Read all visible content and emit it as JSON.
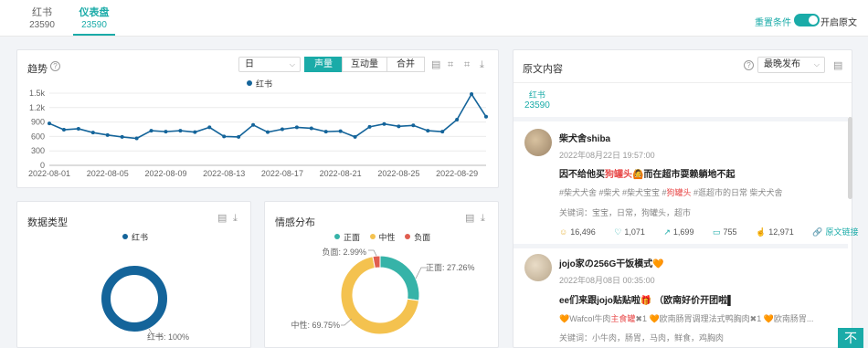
{
  "tabs": [
    {
      "label": "红书",
      "count": "23590"
    },
    {
      "label": "仪表盘",
      "count": "23590"
    }
  ],
  "header": {
    "reset_label": "重置条件",
    "toggle_label": "开启原文",
    "toggle_on": true
  },
  "trend": {
    "title": "趋势",
    "select": "日",
    "segments": [
      "声量",
      "互动量",
      "合并"
    ],
    "active_segment": "声量",
    "legend": "红书"
  },
  "chart_data": [
    {
      "type": "line",
      "title": "",
      "series": [
        {
          "name": "红书",
          "color": "#14649a",
          "values": [
            870,
            740,
            760,
            680,
            630,
            590,
            560,
            720,
            700,
            720,
            690,
            790,
            600,
            590,
            840,
            690,
            750,
            790,
            770,
            700,
            710,
            590,
            800,
            860,
            810,
            830,
            720,
            700,
            950,
            1480,
            1010
          ]
        }
      ],
      "x": [
        "2022-08-01",
        "2022-08-02",
        "2022-08-03",
        "2022-08-04",
        "2022-08-05",
        "2022-08-06",
        "2022-08-07",
        "2022-08-08",
        "2022-08-09",
        "2022-08-10",
        "2022-08-11",
        "2022-08-12",
        "2022-08-13",
        "2022-08-14",
        "2022-08-15",
        "2022-08-16",
        "2022-08-17",
        "2022-08-18",
        "2022-08-19",
        "2022-08-20",
        "2022-08-21",
        "2022-08-22",
        "2022-08-23",
        "2022-08-24",
        "2022-08-25",
        "2022-08-26",
        "2022-08-27",
        "2022-08-28",
        "2022-08-29",
        "2022-08-30",
        "2022-08-31"
      ],
      "x_tick_labels": [
        "2022-08-01",
        "2022-08-05",
        "2022-08-09",
        "2022-08-13",
        "2022-08-17",
        "2022-08-21",
        "2022-08-25",
        "2022-08-29"
      ],
      "y_tick_labels": [
        "0",
        "300",
        "600",
        "900",
        "1.2k",
        "1.5k"
      ],
      "ylim": [
        0,
        1500
      ],
      "grid": true,
      "legend": "top-center"
    },
    {
      "type": "pie",
      "title": "数据类型",
      "labels": [
        "红书"
      ],
      "values": [
        100
      ],
      "colors": [
        "#14649a"
      ],
      "data_labels": [
        "红书: 100%"
      ],
      "legend": "top-center"
    },
    {
      "type": "pie",
      "title": "情感分布",
      "labels": [
        "正面",
        "中性",
        "负面"
      ],
      "values": [
        27.26,
        69.75,
        2.99
      ],
      "colors": [
        "#36b3a8",
        "#f4c24f",
        "#e05d4f"
      ],
      "data_labels": [
        "正面: 27.26%",
        "中性: 69.75%",
        "负面: 2.99%"
      ],
      "legend": "top-center"
    }
  ],
  "datatype": {
    "title": "数据类型",
    "legend": "红书",
    "label": "红书: 100%"
  },
  "sentiment": {
    "title": "情感分布",
    "legend": [
      "正面",
      "中性",
      "负面"
    ],
    "labels": {
      "positive": "正面: 27.26%",
      "neutral": "中性: 69.75%",
      "negative": "负面: 2.99%"
    }
  },
  "original": {
    "title": "原文内容",
    "sort": "最晚发布",
    "source_tab": {
      "label": "红书",
      "count": "23590"
    },
    "posts": [
      {
        "author": "柴犬舍shiba",
        "time": "2022年08月22日 19:57:00",
        "text_pre": "因不给他买",
        "text_hl": "狗罐头",
        "text_post": "🙆而在超市耍赖躺地不起",
        "tags_pre": "#柴犬犬舍 #柴犬 #柴犬宝宝 #",
        "tags_hl": "狗罐头",
        "tags_post": " #逛超市的日常 柴犬犬舍",
        "keywords": "关键词：宝宝，日常，狗罐头，超市",
        "stats": {
          "views": "16,496",
          "likes": "1,071",
          "shares": "1,699",
          "comments": "755",
          "collects": "12,971",
          "link": "原文链接"
        }
      },
      {
        "author": "jojo家の256G干饭模式🧡",
        "time": "2022年08月08日 00:35:00",
        "text": "ee们来跟jojo贴贴啦🎁 （欧南好价开团啦▌",
        "tags_pre": "🧡Wafcol牛肉",
        "tags_hl": "主食罐",
        "tags_post": "✖1 🧡欧南肠胃调理法式鸭胸肉✖1 🧡欧南肠胃...",
        "keywords": "关键词：小牛肉，肠胃，马肉，鲜食，鸡胸肉"
      }
    ]
  },
  "totop": "不"
}
